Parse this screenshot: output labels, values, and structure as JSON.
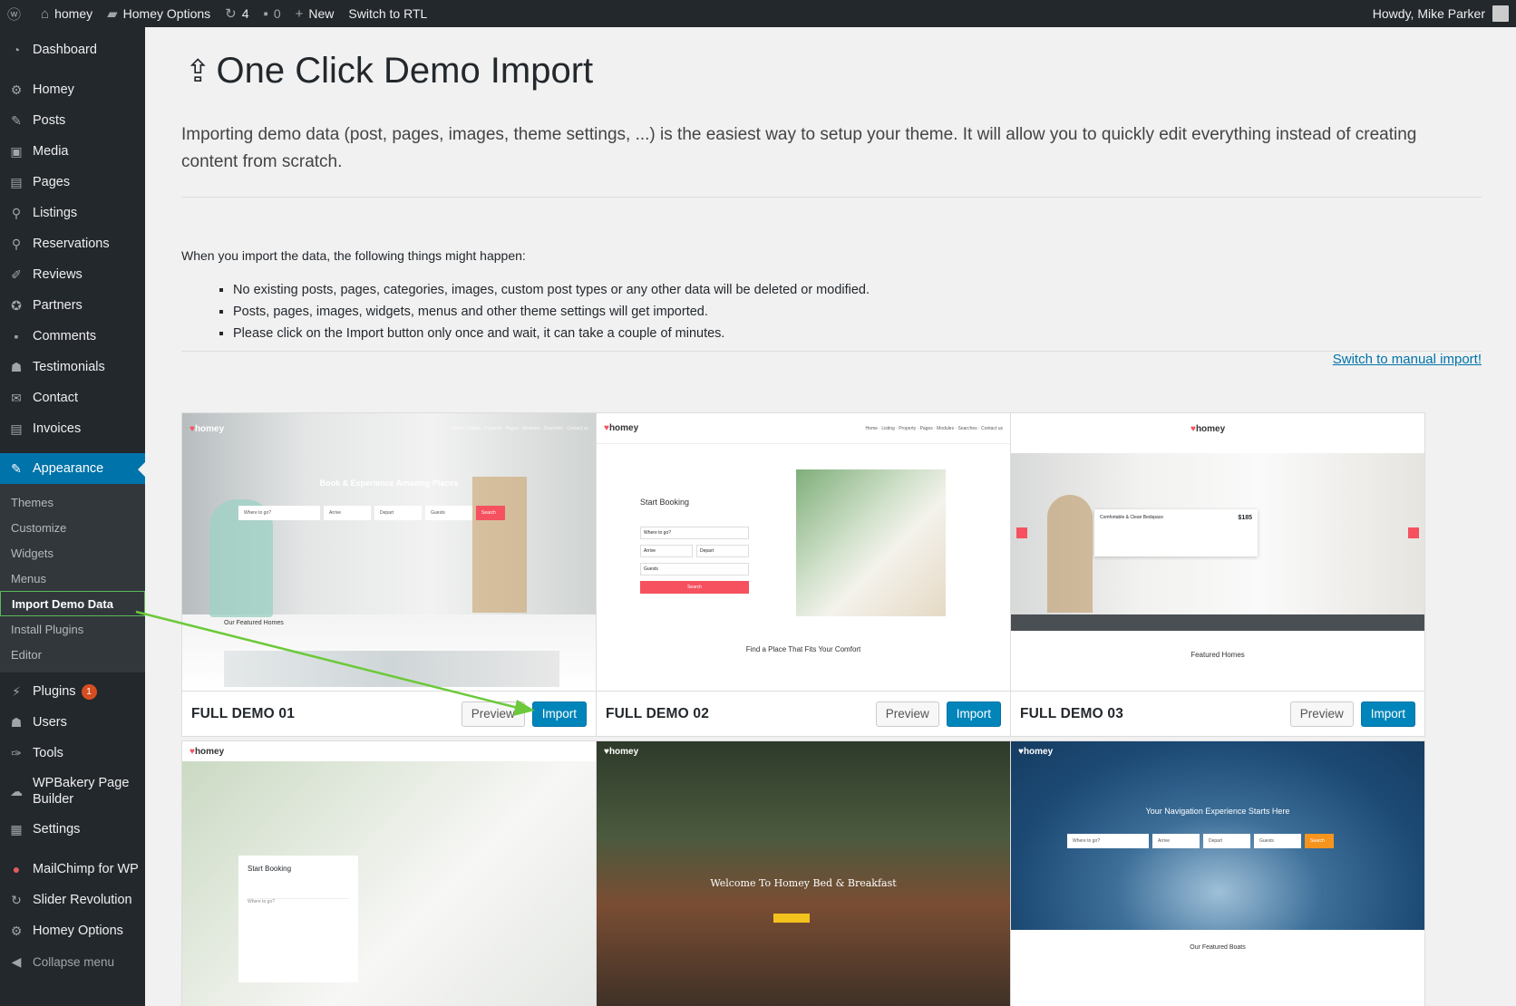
{
  "adminbar": {
    "site_name": "homey",
    "homey_options": "Homey Options",
    "updates_count": "4",
    "comments_count": "0",
    "new_label": "New",
    "rtl_label": "Switch to RTL",
    "howdy": "Howdy, Mike Parker"
  },
  "sidebar": {
    "dashboard": "Dashboard",
    "items": [
      "Homey",
      "Posts",
      "Media",
      "Pages",
      "Listings",
      "Reservations",
      "Reviews",
      "Partners",
      "Comments",
      "Testimonials",
      "Contact",
      "Invoices"
    ],
    "appearance": "Appearance",
    "submenu": [
      "Themes",
      "Customize",
      "Widgets",
      "Menus",
      "Import Demo Data",
      "Install Plugins",
      "Editor"
    ],
    "plugins": "Plugins",
    "plugins_badge": "1",
    "users": "Users",
    "tools": "Tools",
    "wpbakery_1": "WPBakery Page",
    "wpbakery_2": "Builder",
    "settings": "Settings",
    "mailchimp": "MailChimp for WP",
    "slider": "Slider Revolution",
    "homey_options": "Homey Options",
    "collapse": "Collapse menu"
  },
  "main": {
    "title": "One Click Demo Import",
    "intro": "Importing demo data (post, pages, images, theme settings, ...) is the easiest way to setup your theme. It will allow you to quickly edit everything instead of creating content from scratch.",
    "notice": "When you import the data, the following things might happen:",
    "bullets": [
      "No existing posts, pages, categories, images, custom post types or any other data will be deleted or modified.",
      "Posts, pages, images, widgets, menus and other theme settings will get imported.",
      "Please click on the Import button only once and wait, it can take a couple of minutes."
    ],
    "manual_link": "Switch to manual import!"
  },
  "demos": [
    {
      "title": "FULL DEMO 01",
      "preview": "Preview",
      "import": "Import",
      "hero": "Book & Experience Amazing Places",
      "sub": "Our Featured Homes"
    },
    {
      "title": "FULL DEMO 02",
      "preview": "Preview",
      "import": "Import",
      "hero": "Start Booking",
      "sub": "Find a Place That Fits Your Comfort"
    },
    {
      "title": "FULL DEMO 03",
      "preview": "Preview",
      "import": "Import",
      "hero": "Comfortable & Clean Bedspace",
      "price": "$185",
      "sub": "Featured Homes"
    },
    {
      "hero": "Start Booking"
    },
    {
      "hero": "Welcome To Homey Bed & Breakfast"
    },
    {
      "hero": "Your Navigation Experience Starts Here",
      "sub": "Our Featured Boats"
    }
  ],
  "mock": {
    "logo": "homey",
    "search": "Search",
    "where": "Where to go?",
    "arrive": "Arrive",
    "depart": "Depart",
    "guests": "Guests",
    "nav": "Home · Listing · Property · Pages · Modules · Searches · Contact us"
  },
  "colors": {
    "adminbar": "#23282d",
    "accent": "#0073aa",
    "import_btn": "#0085ba",
    "highlight": "#5cb85c",
    "homey_pink": "#f5515f"
  }
}
